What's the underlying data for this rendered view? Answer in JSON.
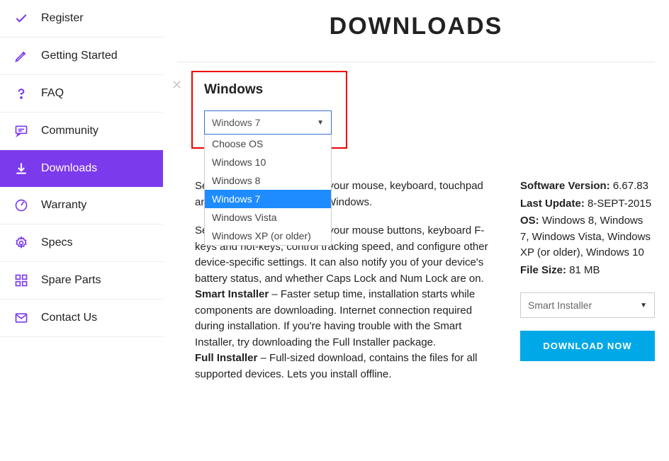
{
  "sidebar": {
    "items": [
      {
        "label": "Register"
      },
      {
        "label": "Getting Started"
      },
      {
        "label": "FAQ"
      },
      {
        "label": "Community"
      },
      {
        "label": "Downloads"
      },
      {
        "label": "Warranty"
      },
      {
        "label": "Specs"
      },
      {
        "label": "Spare Parts"
      },
      {
        "label": "Contact Us"
      }
    ]
  },
  "page_title": "DOWNLOADS",
  "os_picker": {
    "label": "Windows",
    "selected": "Windows 7",
    "options": [
      "Choose OS",
      "Windows 10",
      "Windows 8",
      "Windows 7",
      "Windows Vista",
      "Windows XP (or older)"
    ]
  },
  "description": {
    "para1": "SetPoint lets you customize your mouse, keyboard, touchpad and number pad settings in Windows.",
    "para2": "SetPoint lets you customize your mouse buttons, keyboard F-keys and hot-keys, control tracking speed, and configure other device-specific settings. It can also notify you of your device's battery status, and whether Caps Lock and Num Lock are on.",
    "smart_label": "Smart Installer",
    "smart_text": " – Faster setup time, installation starts while components are downloading. Internet connection required during installation. If you're having trouble with the Smart Installer, try downloading the Full Installer package.",
    "full_label": "Full Installer",
    "full_text": " – Full-sized download, contains the files for all supported devices. Lets you install offline."
  },
  "info": {
    "version_label": "Software Version:",
    "version": "6.67.83",
    "update_label": "Last Update:",
    "update": "8-SEPT-2015",
    "os_label": "OS:",
    "os": "Windows 8, Windows 7, Windows Vista, Windows XP (or older), Windows 10",
    "size_label": "File Size:",
    "size": "81 MB"
  },
  "installer_select": "Smart Installer",
  "download_btn": "DOWNLOAD NOW"
}
